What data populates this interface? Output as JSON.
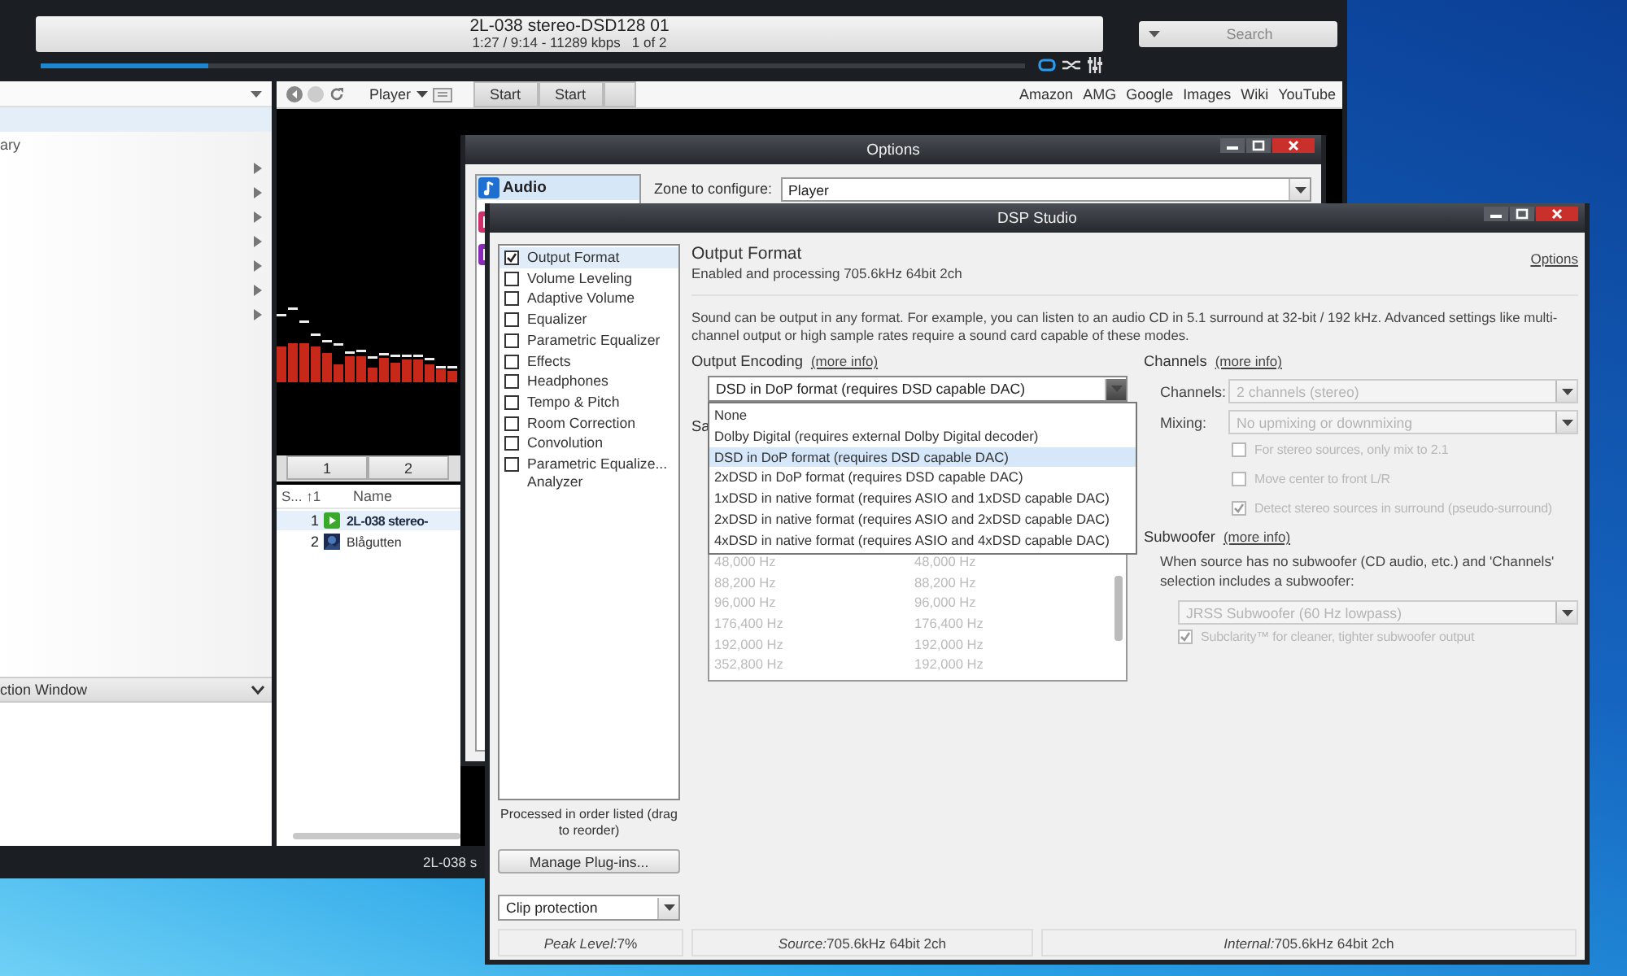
{
  "player": {
    "now_playing": {
      "title": "2L-038 stereo-DSD128 01",
      "info": "1:27 / 9:14 - 11289 kbps   1 of 2"
    },
    "search": {
      "placeholder": "Search"
    },
    "progress": {
      "level": 0.17
    },
    "library": {
      "rows": [
        {
          "selected": true,
          "has_children": false
        },
        {
          "label": "ary",
          "selected": false,
          "has_children": false
        },
        {
          "selected": false,
          "has_children": true
        },
        {
          "selected": false,
          "has_children": true
        },
        {
          "selected": false,
          "has_children": true
        },
        {
          "selected": false,
          "has_children": true
        },
        {
          "selected": false,
          "has_children": true
        },
        {
          "selected": false,
          "has_children": true
        },
        {
          "selected": false,
          "has_children": true
        }
      ]
    },
    "action_window": {
      "label": "ction Window"
    },
    "browser": {
      "player_menu": "Player",
      "tabs": [
        "Start",
        "Start"
      ],
      "links": [
        "Amazon",
        "AMG",
        "Google",
        "Images",
        "Wiki",
        "YouTube"
      ]
    },
    "view_tabs": [
      "1",
      "2"
    ],
    "playlist": {
      "columns": [
        "S... ↑1",
        "Name"
      ],
      "rows": [
        {
          "number": "1",
          "name": "2L-038 stereo-",
          "playing": true,
          "selected": true
        },
        {
          "number": "2",
          "name": "Blågutten",
          "playing": false,
          "selected": false
        }
      ]
    },
    "status": "2L-038 s"
  },
  "options": {
    "title": "Options",
    "sidebar": [
      {
        "label": "Audio",
        "selected": true
      }
    ],
    "zone": {
      "label": "Zone to configure:",
      "value": "Player"
    }
  },
  "dsp": {
    "title": "DSP Studio",
    "plugins": [
      {
        "label": "Output Format",
        "checked": true,
        "selected": true
      },
      {
        "label": "Volume Leveling",
        "checked": false,
        "selected": false
      },
      {
        "label": "Adaptive Volume",
        "checked": false,
        "selected": false
      },
      {
        "label": "Equalizer",
        "checked": false,
        "selected": false
      },
      {
        "label": "Parametric Equalizer",
        "checked": false,
        "selected": false
      },
      {
        "label": "Effects",
        "checked": false,
        "selected": false
      },
      {
        "label": "Headphones",
        "checked": false,
        "selected": false
      },
      {
        "label": "Tempo & Pitch",
        "checked": false,
        "selected": false
      },
      {
        "label": "Room Correction",
        "checked": false,
        "selected": false
      },
      {
        "label": "Convolution",
        "checked": false,
        "selected": false
      },
      {
        "label": "Parametric Equalize...\nAnalyzer",
        "checked": false,
        "selected": false
      }
    ],
    "order_note": "Processed in order listed (drag to reorder)",
    "manage_button": "Manage Plug-ins...",
    "clip": {
      "value": "Clip protection"
    },
    "status": [
      {
        "label": "Peak Level:",
        "value": "7%"
      },
      {
        "label": "Source:",
        "value": "705.6kHz 64bit 2ch"
      },
      {
        "label": "Internal:",
        "value": "705.6kHz 64bit 2ch"
      }
    ],
    "panel": {
      "title": "Output Format",
      "subtitle": "Enabled and processing 705.6kHz 64bit 2ch",
      "options_link": "Options",
      "description": "Sound can be output in any format.  For example, you can listen to an audio CD in 5.1 surround at 32-bit / 192 kHz.  Advanced settings like multi-channel output or high sample rates require a sound card capable of these modes.",
      "encoding": {
        "label": "Output Encoding",
        "link": "(more info)",
        "value": "DSD in DoP format (requires DSD capable DAC)",
        "expanded": true,
        "options": [
          {
            "label": "None",
            "selected": false
          },
          {
            "label": "Dolby Digital (requires external Dolby Digital decoder)",
            "selected": false
          },
          {
            "label": "DSD in DoP format (requires DSD capable DAC)",
            "selected": true
          },
          {
            "label": "2xDSD in DoP format (requires DSD capable DAC)",
            "selected": false
          },
          {
            "label": "1xDSD in native format (requires ASIO and 1xDSD capable DAC)",
            "selected": false
          },
          {
            "label": "2xDSD in native format (requires ASIO and 2xDSD capable DAC)",
            "selected": false
          },
          {
            "label": "4xDSD in native format (requires ASIO and 4xDSD capable DAC)",
            "selected": false
          }
        ]
      },
      "sample_rates": {
        "label": "Sa",
        "rows": [
          [
            "48,000 Hz",
            "48,000 Hz"
          ],
          [
            "88,200 Hz",
            "88,200 Hz"
          ],
          [
            "96,000 Hz",
            "96,000 Hz"
          ],
          [
            "176,400 Hz",
            "176,400 Hz"
          ],
          [
            "192,000 Hz",
            "192,000 Hz"
          ],
          [
            "352,800 Hz",
            "192,000 Hz"
          ]
        ]
      },
      "channels": {
        "label": "Channels",
        "link": "(more info)",
        "fields": [
          {
            "label": "Channels:",
            "value": "2 channels (stereo)",
            "disabled": true
          },
          {
            "label": "Mixing:",
            "value": "No upmixing or downmixing",
            "disabled": true
          }
        ],
        "options": [
          {
            "label": "For stereo sources, only mix to 2.1",
            "checked": false,
            "disabled": true
          },
          {
            "label": "Move center to front L/R",
            "checked": false,
            "disabled": true
          },
          {
            "label": "Detect stereo sources in surround (pseudo-surround)",
            "checked": true,
            "disabled": true
          }
        ]
      },
      "subwoofer": {
        "label": "Subwoofer",
        "link": "(more info)",
        "description": "When source has no subwoofer (CD audio, etc.) and 'Channels' selection includes a subwoofer:",
        "value": "JRSS Subwoofer (60 Hz lowpass)",
        "disabled": true,
        "options": [
          {
            "label": "Subclarity™ for cleaner, tighter subwoofer output",
            "checked": true,
            "disabled": true
          }
        ]
      }
    }
  }
}
